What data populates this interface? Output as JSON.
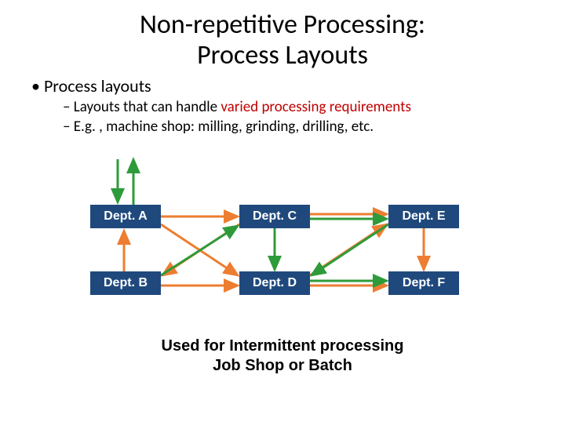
{
  "title_line1": "Non-repetitive Processing:",
  "title_line2": "Process Layouts",
  "bullet1": "Process layouts",
  "bullet2a_pre": "Layouts that can handle ",
  "bullet2a_em": "varied processing requirements",
  "bullet2b": "E.g. , machine shop: milling, grinding, drilling, etc.",
  "dept_a": "Dept. A",
  "dept_b": "Dept. B",
  "dept_c": "Dept. C",
  "dept_d": "Dept. D",
  "dept_e": "Dept. E",
  "dept_f": "Dept. F",
  "caption_line1": "Used for Intermittent processing",
  "caption_line2": "Job Shop or Batch",
  "colors": {
    "box": "#1f497d",
    "orange": "#ed7d31",
    "green": "#2e9b3a",
    "red_text": "#c00000"
  }
}
